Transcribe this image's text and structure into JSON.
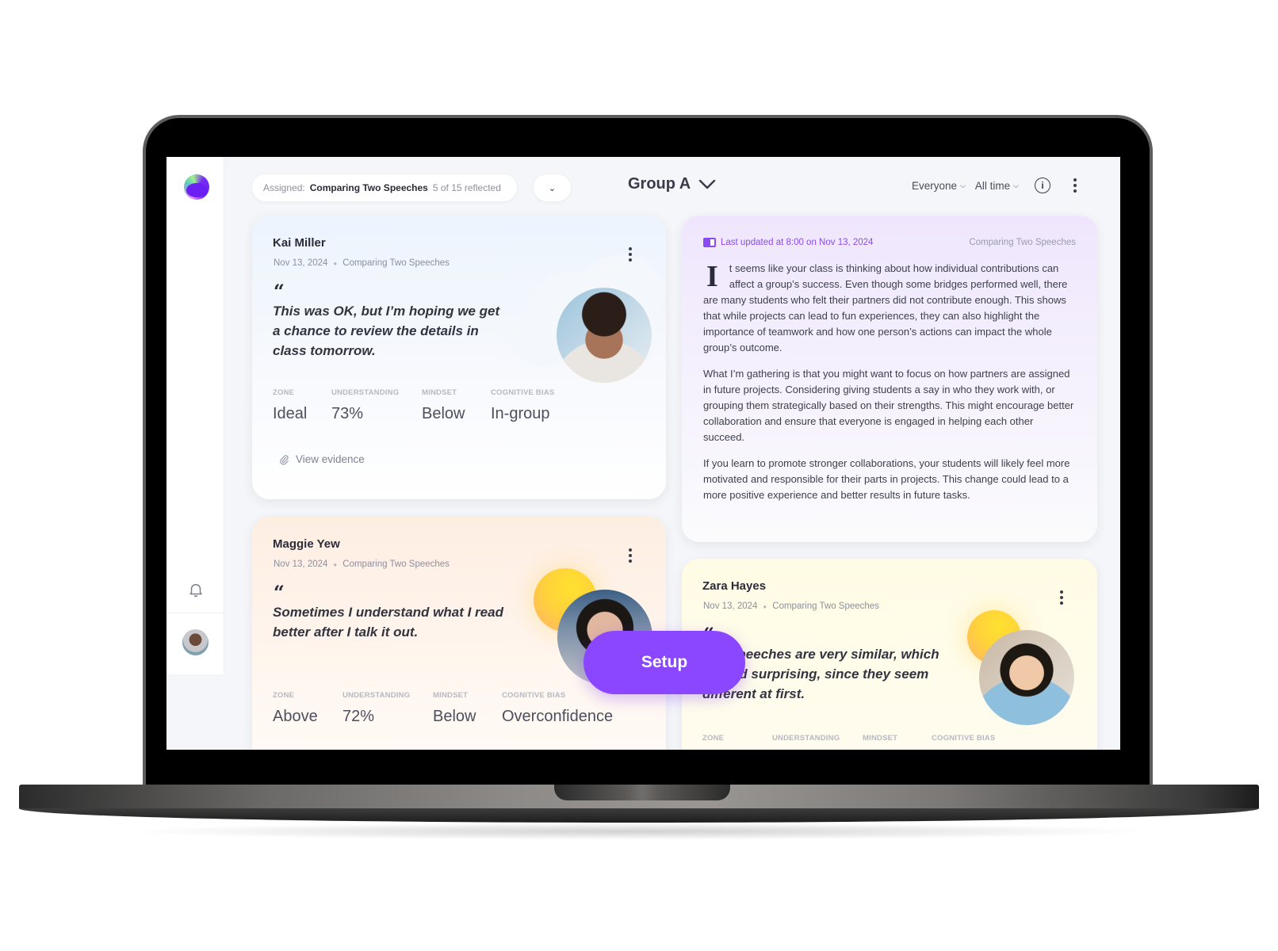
{
  "topbar": {
    "assigned_label": "Assigned:",
    "assigned_value": "Comparing Two Speeches",
    "reflected_count": "5 of 15 reflected",
    "group_title": "Group A",
    "filter_audience": "Everyone",
    "filter_time": "All time",
    "info_glyph": "i"
  },
  "sidebar": {
    "icons": [
      "app-logo",
      "bell-icon",
      "user-avatar"
    ]
  },
  "cards": [
    {
      "name": "Kai Miller",
      "date": "Nov 13, 2024",
      "topic": "Comparing Two Speeches",
      "quote": "This was OK, but I’m hoping we get a chance to review the details in class tomorrow.",
      "metrics": [
        {
          "label": "Zone",
          "value": "Ideal"
        },
        {
          "label": "Understanding",
          "value": "73%"
        },
        {
          "label": "Mindset",
          "value": "Below"
        },
        {
          "label": "Cognitive Bias",
          "value": "In-group"
        }
      ],
      "evidence_label": "View evidence"
    },
    {
      "name": "Maggie Yew",
      "date": "Nov 13, 2024",
      "topic": "Comparing Two Speeches",
      "quote": "Sometimes I understand what I read better after I talk it out.",
      "metrics": [
        {
          "label": "Zone",
          "value": "Above"
        },
        {
          "label": "Understanding",
          "value": "72%"
        },
        {
          "label": "Mindset",
          "value": "Below"
        },
        {
          "label": "Cognitive Bias",
          "value": "Overconfidence"
        }
      ]
    },
    {
      "name": "Zara Hayes",
      "date": "Nov 13, 2024",
      "topic": "Comparing Two Speeches",
      "quote": "The speeches are very similar, which I found surprising, since they seem different at first.",
      "metrics": [
        {
          "label": "Zone",
          "value": ""
        },
        {
          "label": "Understanding",
          "value": ""
        },
        {
          "label": "Mindset",
          "value": ""
        },
        {
          "label": "Cognitive Bias",
          "value": ""
        }
      ]
    }
  ],
  "summary": {
    "updated": "Last updated at 8:00 on Nov 13, 2024",
    "topic": "Comparing Two Speeches",
    "dropcap": "I",
    "p1": "t seems like your class is thinking about how individual contributions can affect a group’s success. Even though some bridges performed well, there are many students who felt their partners did not contribute enough. This shows that while projects can lead to fun experiences, they can also highlight the importance of teamwork and how one person’s actions can impact the whole group’s outcome.",
    "p2": "What I’m gathering is that you might want to focus on how partners are assigned in future projects. Considering giving students a say in who they work with, or grouping them strategically based on their strengths. This might encourage better collaboration and ensure that everyone is engaged in helping each other succeed.",
    "p3": "If you learn to promote stronger collaborations, your students will likely feel more motivated and responsible for their parts in projects. This change could lead to a more positive experience and better results in future tasks."
  },
  "setup_button": "Setup",
  "colors": {
    "accent": "#8b46ff",
    "ai_label": "#8a4cf0"
  }
}
